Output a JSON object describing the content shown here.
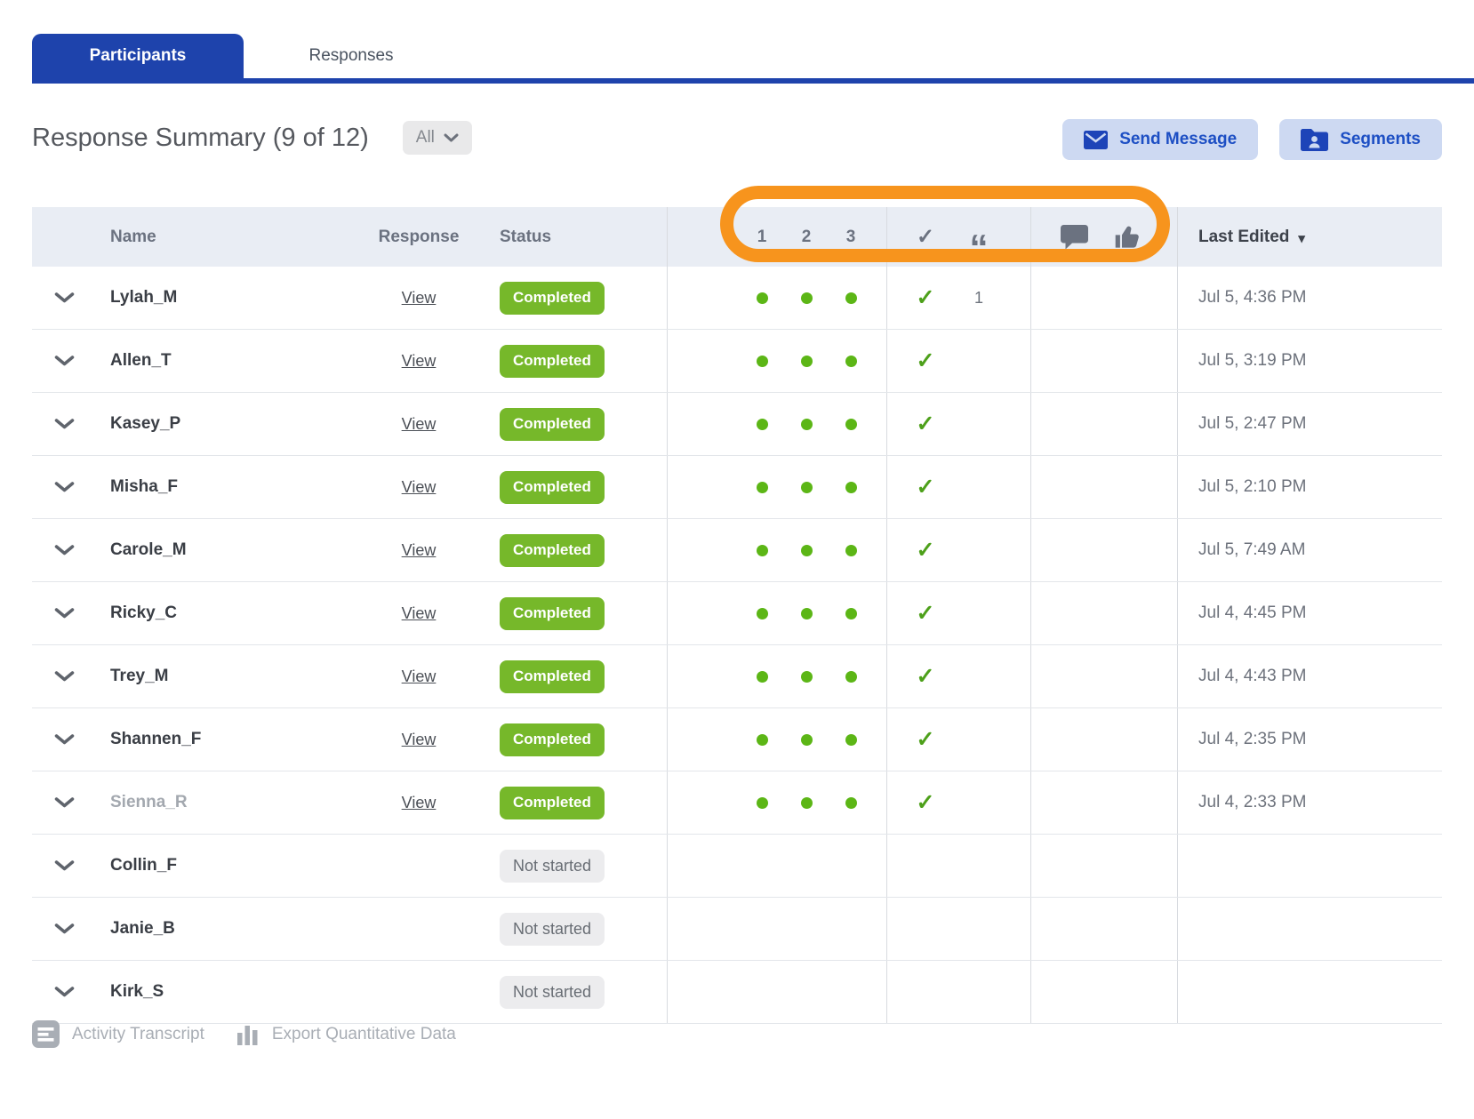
{
  "tabs": {
    "participants": "Participants",
    "responses": "Responses"
  },
  "toolbar": {
    "title": "Response Summary (9 of 12)",
    "filter_value": "All",
    "send_message_label": "Send Message",
    "segments_label": "Segments"
  },
  "table": {
    "headers": {
      "name": "Name",
      "response": "Response",
      "status": "Status",
      "col1": "1",
      "col2": "2",
      "col3": "3",
      "last_edited": "Last Edited"
    },
    "header_icons": [
      "check-icon",
      "quote-icon",
      "comment-icon",
      "thumbs-up-icon"
    ],
    "rows": [
      {
        "name": "Lylah_M",
        "response_link": "View",
        "status": "Completed",
        "status_type": "completed",
        "dots": true,
        "check": true,
        "quote_count": "1",
        "last_edited": "Jul 5, 4:36 PM",
        "dimmed": false
      },
      {
        "name": "Allen_T",
        "response_link": "View",
        "status": "Completed",
        "status_type": "completed",
        "dots": true,
        "check": true,
        "quote_count": "",
        "last_edited": "Jul 5, 3:19 PM",
        "dimmed": false
      },
      {
        "name": "Kasey_P",
        "response_link": "View",
        "status": "Completed",
        "status_type": "completed",
        "dots": true,
        "check": true,
        "quote_count": "",
        "last_edited": "Jul 5, 2:47 PM",
        "dimmed": false
      },
      {
        "name": "Misha_F",
        "response_link": "View",
        "status": "Completed",
        "status_type": "completed",
        "dots": true,
        "check": true,
        "quote_count": "",
        "last_edited": "Jul 5, 2:10 PM",
        "dimmed": false
      },
      {
        "name": "Carole_M",
        "response_link": "View",
        "status": "Completed",
        "status_type": "completed",
        "dots": true,
        "check": true,
        "quote_count": "",
        "last_edited": "Jul 5, 7:49 AM",
        "dimmed": false
      },
      {
        "name": "Ricky_C",
        "response_link": "View",
        "status": "Completed",
        "status_type": "completed",
        "dots": true,
        "check": true,
        "quote_count": "",
        "last_edited": "Jul 4, 4:45 PM",
        "dimmed": false
      },
      {
        "name": "Trey_M",
        "response_link": "View",
        "status": "Completed",
        "status_type": "completed",
        "dots": true,
        "check": true,
        "quote_count": "",
        "last_edited": "Jul 4, 4:43 PM",
        "dimmed": false
      },
      {
        "name": "Shannen_F",
        "response_link": "View",
        "status": "Completed",
        "status_type": "completed",
        "dots": true,
        "check": true,
        "quote_count": "",
        "last_edited": "Jul 4, 2:35 PM",
        "dimmed": false
      },
      {
        "name": "Sienna_R",
        "response_link": "View",
        "status": "Completed",
        "status_type": "completed",
        "dots": true,
        "check": true,
        "quote_count": "",
        "last_edited": "Jul 4, 2:33 PM",
        "dimmed": true
      },
      {
        "name": "Collin_F",
        "response_link": "",
        "status": "Not started",
        "status_type": "not_started",
        "dots": false,
        "check": false,
        "quote_count": "",
        "last_edited": "",
        "dimmed": false
      },
      {
        "name": "Janie_B",
        "response_link": "",
        "status": "Not started",
        "status_type": "not_started",
        "dots": false,
        "check": false,
        "quote_count": "",
        "last_edited": "",
        "dimmed": false
      },
      {
        "name": "Kirk_S",
        "response_link": "",
        "status": "Not started",
        "status_type": "not_started",
        "dots": false,
        "check": false,
        "quote_count": "",
        "last_edited": "",
        "dimmed": false
      }
    ]
  },
  "footer": {
    "activity_transcript": "Activity Transcript",
    "export_quantitative": "Export Quantitative Data"
  },
  "colors": {
    "brand_blue": "#1e43ac",
    "button_bg": "#cdd9f2",
    "button_text": "#1d4fc4",
    "green_badge": "#76b82a",
    "green_dot": "#5cb616",
    "green_check": "#4da01a",
    "orange_annotation": "#f7941d",
    "header_bg": "#e9edf4",
    "muted_badge_bg": "#ececee"
  }
}
